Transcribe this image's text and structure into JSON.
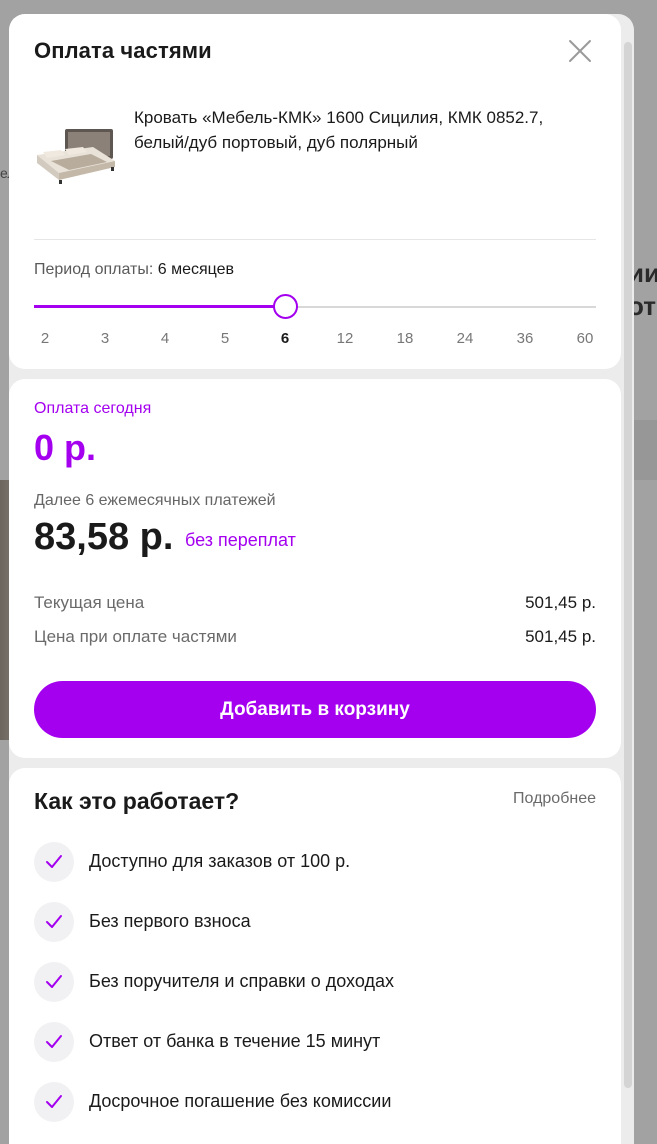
{
  "background": {
    "fragment_1": "ел",
    "fragment_2": "ии",
    "fragment_3": "от"
  },
  "modal": {
    "title": "Оплата частями",
    "product_name": "Кровать «Мебель-КМК» 1600 Сицилия, КМК 0852.7, белый/дуб портовый, дуб полярный",
    "period_label": "Период оплаты:",
    "period_value": "6 месяцев",
    "months": [
      "2",
      "3",
      "4",
      "5",
      "6",
      "12",
      "18",
      "24",
      "36",
      "60"
    ],
    "selected_month": "6",
    "slider_progress": 0.4444
  },
  "payment": {
    "today_label": "Оплата сегодня",
    "today_amount": "0 р.",
    "next_label": "Далее 6 ежемесячных платежей",
    "monthly_amount": "83,58 р.",
    "no_overpay": "без переплат",
    "current_price_label": "Текущая цена",
    "current_price": "501,45 р.",
    "installment_price_label": "Цена при оплате частями",
    "installment_price": "501,45 р.",
    "add_to_cart": "Добавить в корзину"
  },
  "how": {
    "title": "Как это работает?",
    "more": "Подробнее",
    "features": [
      "Доступно для заказов от 100 р.",
      "Без первого взноса",
      "Без поручителя и справки о доходах",
      "Ответ от банка в течение 15 минут",
      "Досрочное погашение без комиссии"
    ]
  },
  "colors": {
    "accent": "#a400ef",
    "overlay": "#9a9a9a"
  }
}
